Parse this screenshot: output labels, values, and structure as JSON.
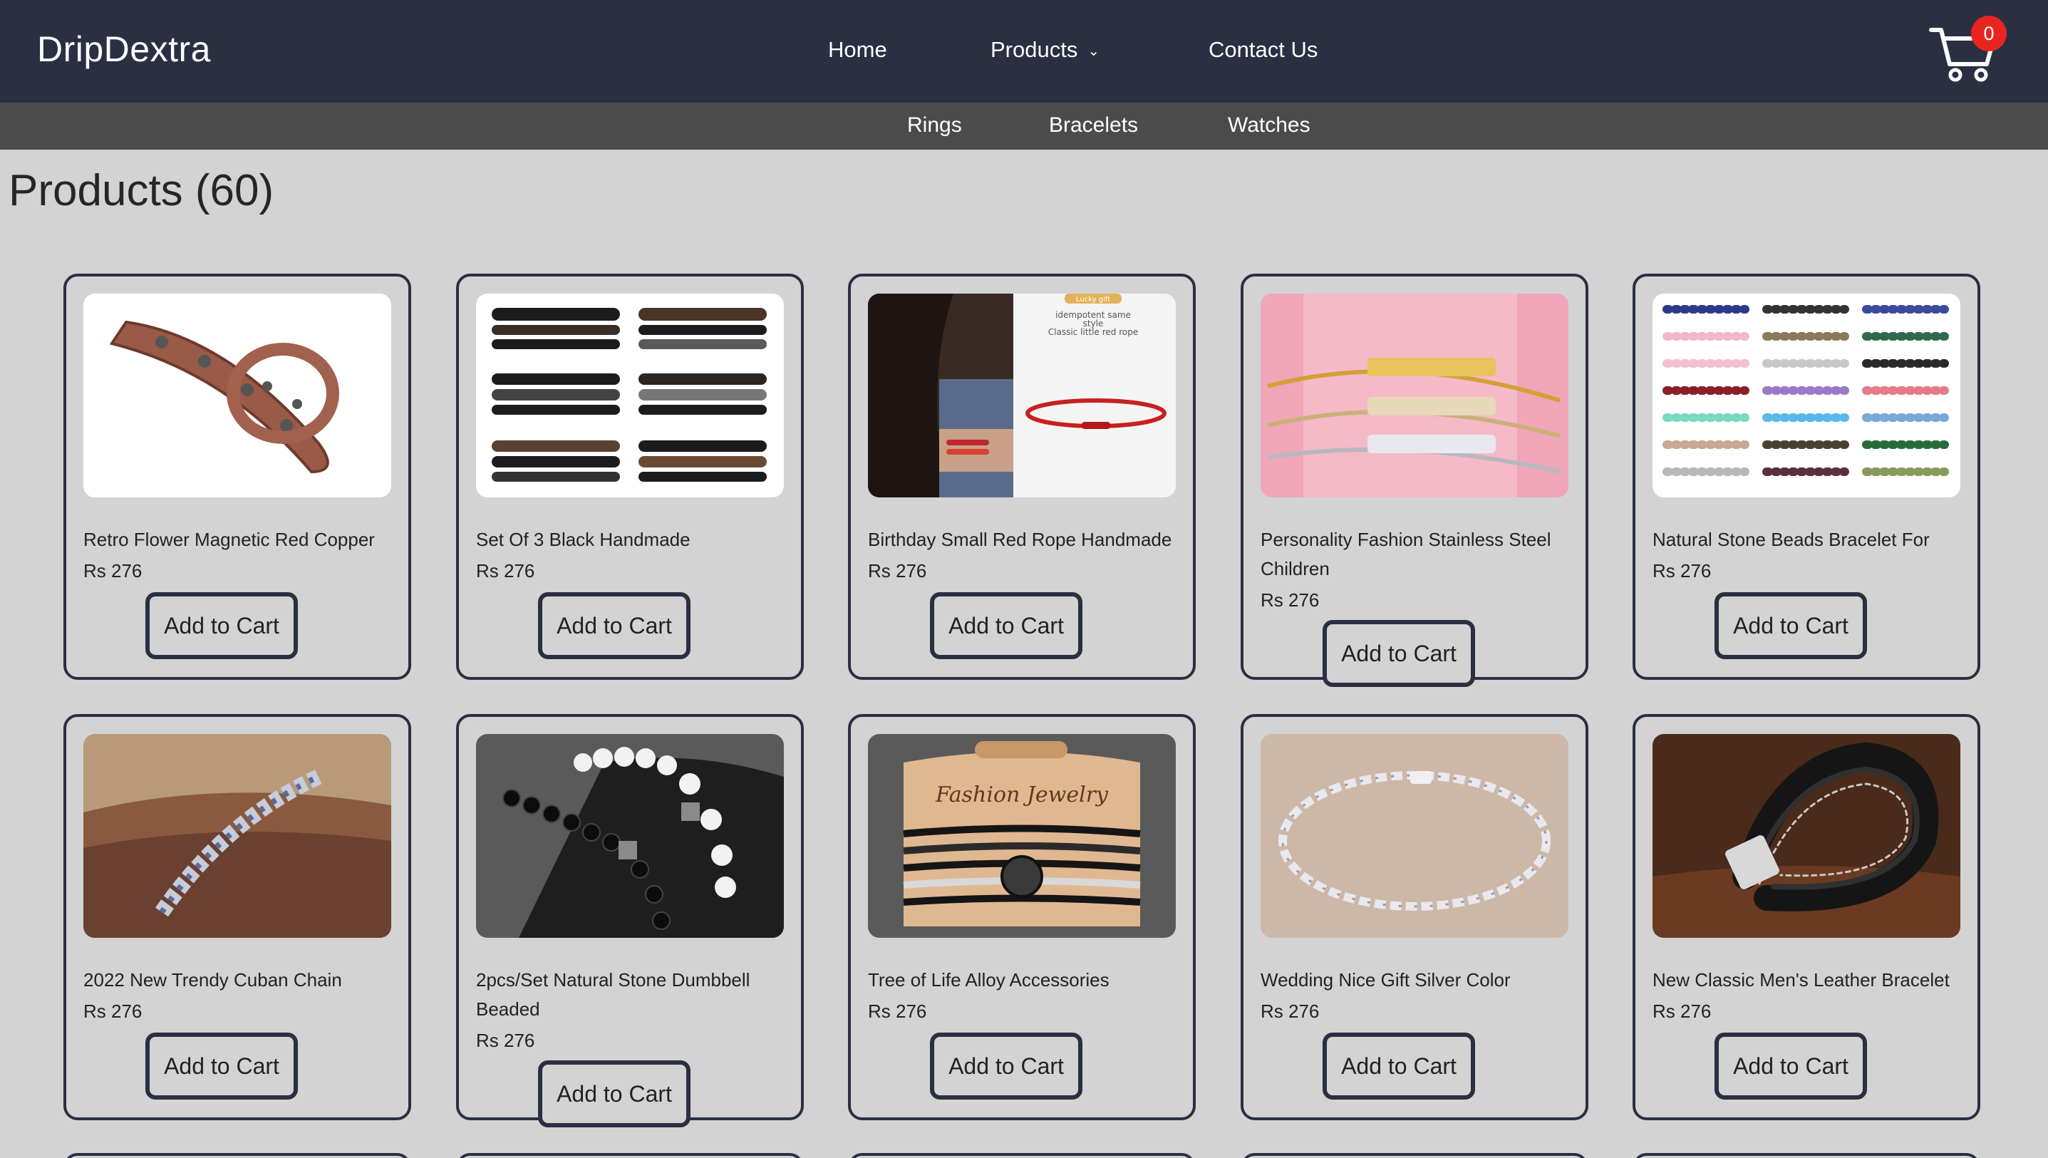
{
  "header": {
    "brand": "DripDextra",
    "nav": {
      "home": "Home",
      "products": "Products",
      "contact": "Contact Us"
    },
    "cart_count": "0"
  },
  "subnav": {
    "rings": "Rings",
    "bracelets": "Bracelets",
    "watches": "Watches"
  },
  "page": {
    "title": "Products (60)"
  },
  "add_to_cart_label": "Add to Cart",
  "products": [
    {
      "name": "Retro Flower Magnetic Red Copper",
      "price": "Rs 276"
    },
    {
      "name": "Set Of 3 Black Handmade",
      "price": "Rs 276"
    },
    {
      "name": "Birthday Small Red Rope Handmade",
      "price": "Rs 276",
      "image_text": {
        "tag": "Lucky gift",
        "line1": "idempotent same",
        "line2": "style",
        "line3": "Classic little red rope"
      }
    },
    {
      "name": "Personality Fashion Stainless Steel Children",
      "price": "Rs 276"
    },
    {
      "name": "Natural Stone Beads Bracelet For",
      "price": "Rs 276"
    },
    {
      "name": "2022 New Trendy Cuban Chain",
      "price": "Rs 276"
    },
    {
      "name": "2pcs/Set Natural Stone Dumbbell Beaded",
      "price": "Rs 276"
    },
    {
      "name": "Tree of Life Alloy Accessories",
      "price": "Rs 276",
      "image_text": {
        "card_label": "Fashion Jewelry"
      }
    },
    {
      "name": "Wedding Nice Gift Silver Color",
      "price": "Rs 276"
    },
    {
      "name": "New Classic Men's Leather Bracelet",
      "price": "Rs 276"
    }
  ],
  "colors": {
    "header_bg": "#2a2f42",
    "subnav_bg": "#4b4b4b",
    "page_bg": "#d3d3d3",
    "badge": "#e82520"
  }
}
